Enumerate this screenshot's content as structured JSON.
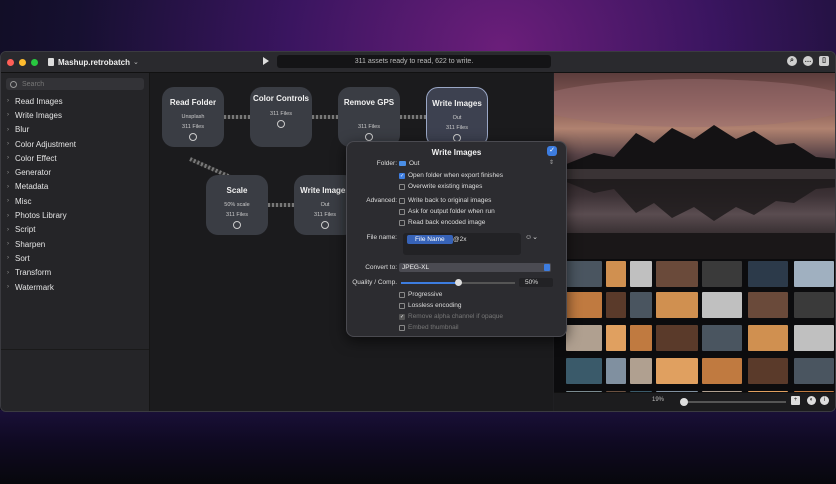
{
  "window": {
    "title": "Mashup.retrobatch",
    "status": "311 assets ready to read, 622 to write."
  },
  "sidebar": {
    "search_placeholder": "Search",
    "items": [
      "Read Images",
      "Write Images",
      "Blur",
      "Color Adjustment",
      "Color Effect",
      "Generator",
      "Metadata",
      "Misc",
      "Photos Library",
      "Script",
      "Sharpen",
      "Sort",
      "Transform",
      "Watermark"
    ]
  },
  "nodes": {
    "read_folder": {
      "title": "Read Folder",
      "sub": "Unsplash",
      "files": "311 Files"
    },
    "color_controls": {
      "title": "Color Controls",
      "sub": "",
      "files": "311 Files"
    },
    "remove_gps": {
      "title": "Remove GPS",
      "sub": "",
      "files": "311 Files"
    },
    "write_images_1": {
      "title": "Write Images",
      "sub": "Out",
      "files": "311 Files"
    },
    "scale": {
      "title": "Scale",
      "sub": "50% scale",
      "files": "311 Files"
    },
    "write_images_2": {
      "title": "Write Images",
      "sub": "Out",
      "files": "311 Files"
    }
  },
  "popover": {
    "title": "Write Images",
    "folder_label": "Folder:",
    "folder_value": "Out",
    "open_folder": "Open folder when export finishes",
    "overwrite": "Overwrite existing images",
    "advanced_label": "Advanced:",
    "write_back": "Write back to original images",
    "ask_output": "Ask for output folder when run",
    "read_back": "Read back encoded image",
    "file_name_label": "File name:",
    "file_name_token": "File Name",
    "file_name_suffix": "@2x",
    "convert_label": "Convert to:",
    "convert_value": "JPEG-XL",
    "quality_label": "Quality / Comp.",
    "quality_value": "50%",
    "quality_level": 0.5,
    "progressive": "Progressive",
    "lossless": "Lossless encoding",
    "remove_alpha": "Remove alpha channel if opaque",
    "embed_thumb": "Embed thumbnail"
  },
  "preview": {
    "zoom": "19%"
  }
}
